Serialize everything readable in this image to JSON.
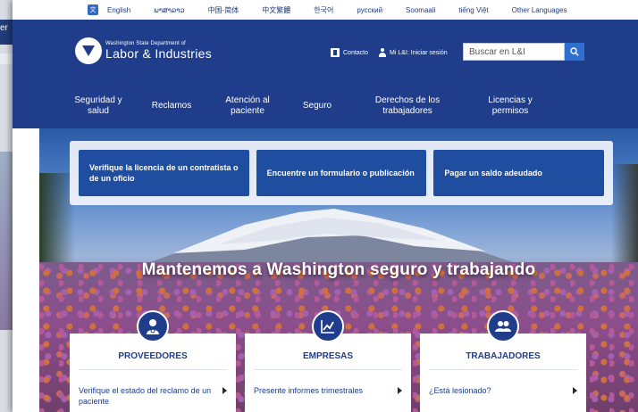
{
  "background_window": {
    "title_fragment": "er"
  },
  "languages": [
    "English",
    "ພາສາລາວ",
    "中国-简体",
    "中文繁體",
    "한국어",
    "русский",
    "Soomaali",
    "tiếng Việt",
    "Other Languages"
  ],
  "header": {
    "logo_small": "Washington State Department of",
    "logo_big": "Labor & Industries",
    "contact_label": "Contacto",
    "login_label": "Mi L&I: Iniciar sesión",
    "search_placeholder": "Buscar en L&I"
  },
  "nav": [
    "Seguridad y\nsalud",
    "Reclamos",
    "Atención al\npaciente",
    "Seguro",
    "Derechos de los\ntrabajadores",
    "Licencias y\npermisos"
  ],
  "quick_actions": [
    "Verifique la licencia de un contratista o de un oficio",
    "Encuentre un formulario o publicación",
    "Pagar un saldo adeudado"
  ],
  "tagline": "Mantenemos a Washington seguro y trabajando",
  "cards": [
    {
      "title": "PROVEEDORES",
      "icon": "provider-icon",
      "link": "Verifique el estado del reclamo de un paciente"
    },
    {
      "title": "EMPRESAS",
      "icon": "chart-icon",
      "link": "Presente informes trimestrales"
    },
    {
      "title": "TRABAJADORES",
      "icon": "workers-icon",
      "link": "¿Está lesionado?"
    }
  ],
  "colors": {
    "brand_navy": "#1f3d8a",
    "button_blue": "#1f4ea0",
    "search_blue": "#2f6fd0"
  }
}
